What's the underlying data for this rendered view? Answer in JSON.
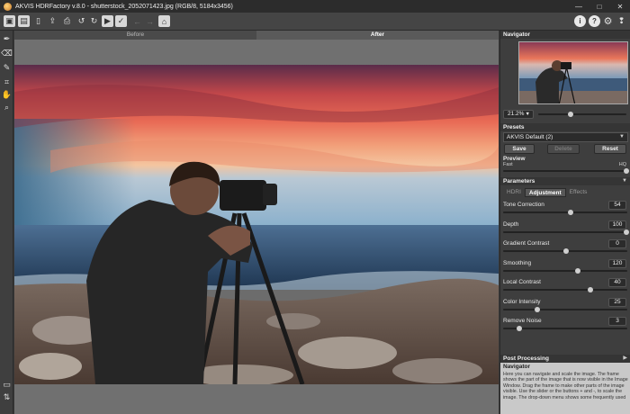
{
  "window": {
    "title": "AKVIS HDRFactory v.8.0 - shutterstock_2052071423.jpg (RGB/8, 5184x3456)"
  },
  "window_controls": {
    "minimize": "—",
    "maximize": "□",
    "close": "✕"
  },
  "toolbar": {
    "icons": [
      "open-image-icon",
      "batch-processing-icon",
      "save-icon",
      "share-icon",
      "print-icon",
      "undo-icon",
      "redo-icon",
      "run-processing-icon",
      "apply-icon",
      "back-icon",
      "forward-icon",
      "plugins-icon"
    ],
    "right_icons": [
      "about-icon",
      "help-icon",
      "settings-icon",
      "hints-icon"
    ]
  },
  "tools": [
    "eyedropper-icon",
    "eraser-icon",
    "brush-icon",
    "crop-icon",
    "hand-icon",
    "zoom-icon"
  ],
  "view_tabs": {
    "before": "Before",
    "after": "After"
  },
  "navigator": {
    "title": "Navigator",
    "zoom": "21.2%",
    "zoom_fraction": 0.35
  },
  "presets": {
    "title": "Presets",
    "selected": "AKVIS Default (2)",
    "save": "Save",
    "delete": "Delete",
    "reset": "Reset",
    "preview_label": "Preview",
    "fast": "Fast",
    "hq": "HQ",
    "preview_fraction": 1.0
  },
  "parameters": {
    "title": "Parameters",
    "tabs": [
      "HDRI",
      "Adjustment",
      "Effects"
    ],
    "active_tab": 1,
    "items": [
      {
        "label": "Tone Correction",
        "value": "54",
        "fraction": 0.54
      },
      {
        "label": "Depth",
        "value": "100",
        "fraction": 1.0
      },
      {
        "label": "Gradient Contrast",
        "value": "0",
        "fraction": 0.5
      },
      {
        "label": "Smoothing",
        "value": "120",
        "fraction": 0.6
      },
      {
        "label": "Local Contrast",
        "value": "40",
        "fraction": 0.7
      },
      {
        "label": "Color Intensity",
        "value": "25",
        "fraction": 0.27
      },
      {
        "label": "Remove Noise",
        "value": "3",
        "fraction": 0.12
      }
    ]
  },
  "post_processing": {
    "title": "Post Processing"
  },
  "help": {
    "title": "Navigator",
    "text": "Here you can navigate and scale the image. The frame shows the part of the image that is now visible in the Image Window. Drag the frame to make other parts of the image visible. Use the slider or the buttons + and -, to scale the image. The drop-down menu shows some frequently used"
  }
}
